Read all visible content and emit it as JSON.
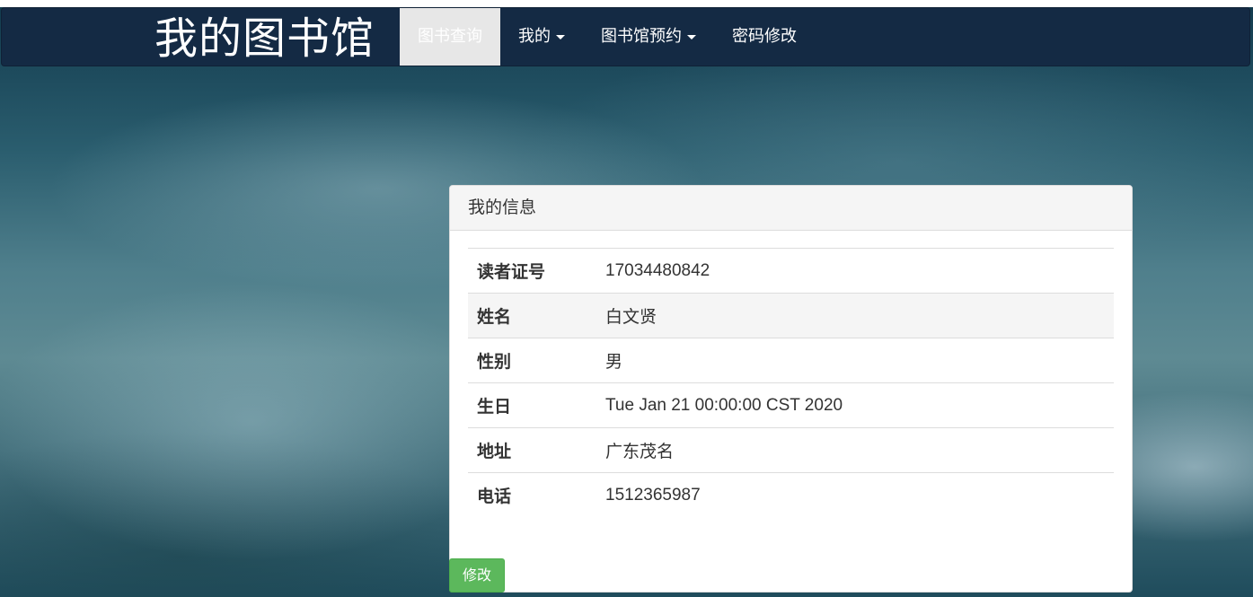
{
  "navbar": {
    "brand": "我的图书馆",
    "items": [
      {
        "label": "图书查询",
        "active": true,
        "dropdown": false
      },
      {
        "label": "我的",
        "active": false,
        "dropdown": true
      },
      {
        "label": "图书馆预约",
        "active": false,
        "dropdown": true
      },
      {
        "label": "密码修改",
        "active": false,
        "dropdown": false
      }
    ]
  },
  "panel": {
    "title": "我的信息",
    "rows": [
      {
        "label": "读者证号",
        "value": "17034480842"
      },
      {
        "label": "姓名",
        "value": "白文贤"
      },
      {
        "label": "性别",
        "value": "男"
      },
      {
        "label": "生日",
        "value": "Tue Jan 21 00:00:00 CST 2020"
      },
      {
        "label": "地址",
        "value": "广东茂名"
      },
      {
        "label": "电话",
        "value": "1512365987"
      }
    ],
    "edit_label": "修改"
  },
  "colors": {
    "navbar_bg": "#142a44",
    "active_tab_bg": "#e7e7e7",
    "edit_button": "#5cb85c"
  }
}
